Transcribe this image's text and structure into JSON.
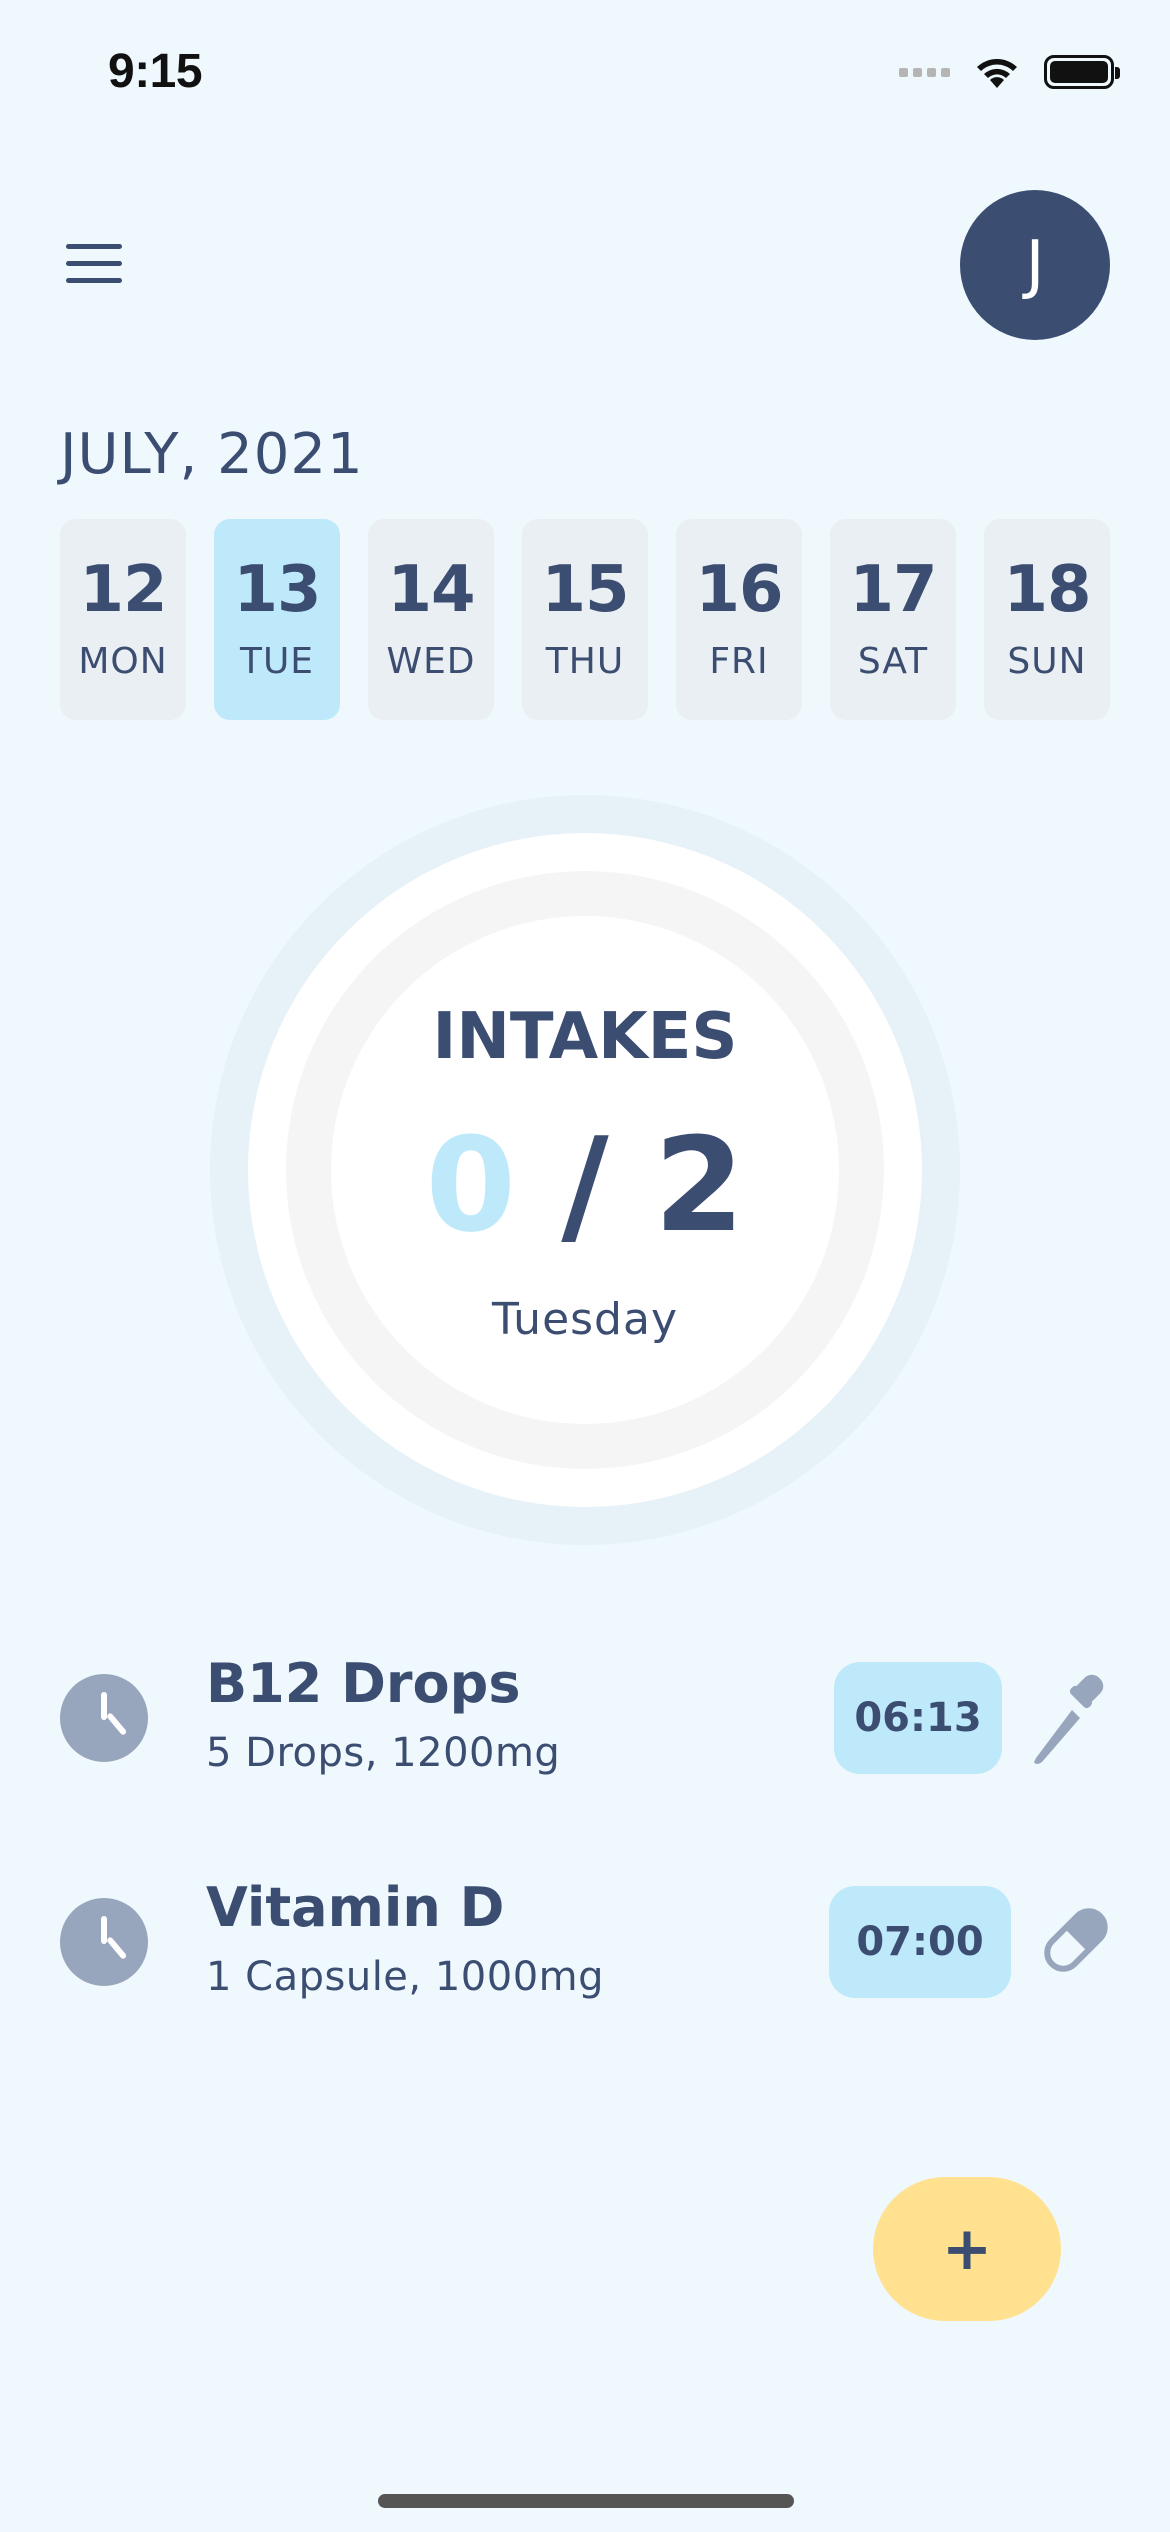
{
  "status_bar": {
    "time": "9:15"
  },
  "header": {
    "avatar_initial": "J"
  },
  "calendar": {
    "month": "JULY, 2021",
    "days": [
      {
        "num": "12",
        "name": "MON"
      },
      {
        "num": "13",
        "name": "TUE"
      },
      {
        "num": "14",
        "name": "WED"
      },
      {
        "num": "15",
        "name": "THU"
      },
      {
        "num": "16",
        "name": "FRI"
      },
      {
        "num": "17",
        "name": "SAT"
      },
      {
        "num": "18",
        "name": "SUN"
      }
    ],
    "selected_day": "13"
  },
  "summary": {
    "title": "INTAKES",
    "taken": "0",
    "separator": "/",
    "total": "2",
    "day_label": "Tuesday"
  },
  "medications": [
    {
      "name": "B12 Drops",
      "dose": "5 Drops, 1200mg",
      "time": "06:13",
      "icon": "dropper-icon"
    },
    {
      "name": "Vitamin D",
      "dose": "1 Capsule, 1000mg",
      "time": "07:00",
      "icon": "capsule-icon"
    }
  ],
  "fab": {
    "label": "+"
  },
  "colors": {
    "background": "#EEF8FD",
    "text": "#3C4D72",
    "accent": "#BEE9FA",
    "fab": "#FFE190",
    "day_inactive": "#E9EFF3",
    "icon_grey": "#98A6BD"
  }
}
